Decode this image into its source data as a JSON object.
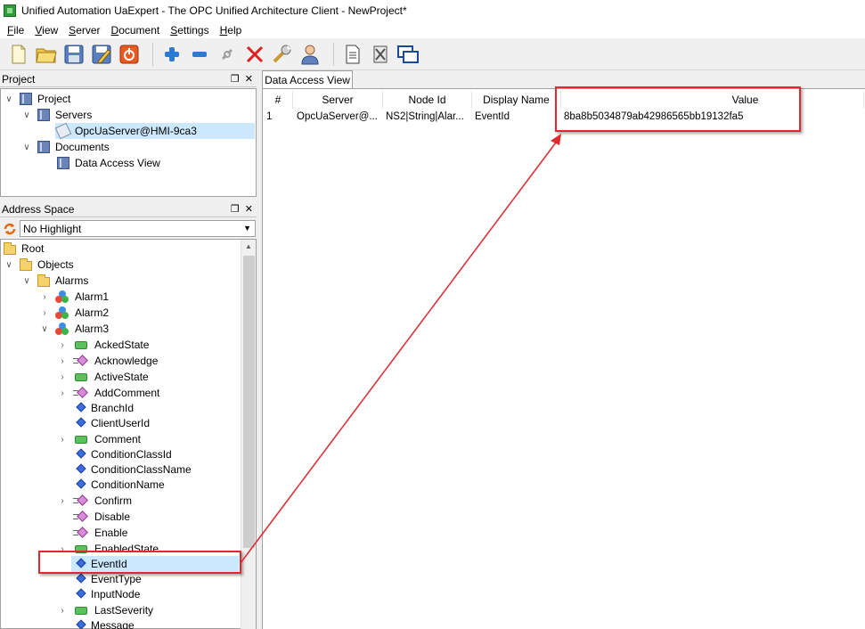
{
  "window": {
    "title": "Unified Automation UaExpert - The OPC Unified Architecture Client - NewProject*"
  },
  "menu": [
    {
      "mnemonic": "F",
      "rest": "ile"
    },
    {
      "mnemonic": "V",
      "rest": "iew"
    },
    {
      "mnemonic": "S",
      "rest": "erver"
    },
    {
      "mnemonic": "D",
      "rest": "ocument"
    },
    {
      "mnemonic": "S",
      "rest": "ettings"
    },
    {
      "mnemonic": "H",
      "rest": "elp"
    }
  ],
  "toolbar": {
    "icons": [
      "new-project-icon",
      "open-project-icon",
      "save-project-icon",
      "save-as-icon",
      "power-icon",
      "add-server-icon",
      "remove-server-icon",
      "connect-icon",
      "disconnect-icon",
      "settings-icon",
      "user-icon",
      "add-document-icon",
      "remove-document-icon",
      "window-icon"
    ]
  },
  "project_pane": {
    "title": "Project",
    "items": {
      "project": "Project",
      "servers": "Servers",
      "server": "OpcUaServer@HMI-9ca3",
      "documents": "Documents",
      "dav": "Data Access View"
    }
  },
  "address_pane": {
    "title": "Address Space",
    "highlight": "No Highlight",
    "tree": {
      "root": "Root",
      "objects": "Objects",
      "alarms": "Alarms",
      "alarm1": "Alarm1",
      "alarm2": "Alarm2",
      "alarm3": "Alarm3",
      "acked_state": "AckedState",
      "acknowledge": "Acknowledge",
      "active_state": "ActiveState",
      "add_comment": "AddComment",
      "branch_id": "BranchId",
      "client_user_id": "ClientUserId",
      "comment": "Comment",
      "condition_class_id": "ConditionClassId",
      "condition_class_name": "ConditionClassName",
      "condition_name": "ConditionName",
      "confirm": "Confirm",
      "disable": "Disable",
      "enable": "Enable",
      "enabled_state": "EnabledState",
      "event_id": "EventId",
      "event_type": "EventType",
      "input_node": "InputNode",
      "last_severity": "LastSeverity",
      "message": "Message"
    }
  },
  "data_access_view": {
    "tab": "Data Access View",
    "columns": {
      "num": "#",
      "server": "Server",
      "node_id": "Node Id",
      "display_name": "Display Name",
      "value": "Value"
    },
    "rows": [
      {
        "num": "1",
        "server": "OpcUaServer@...",
        "node_id": "NS2|String|Alar...",
        "display_name": "EventId",
        "value": "8ba8b5034879ab42986565bb19132fa5"
      }
    ]
  },
  "annotation": {
    "color": "#e0282e"
  }
}
